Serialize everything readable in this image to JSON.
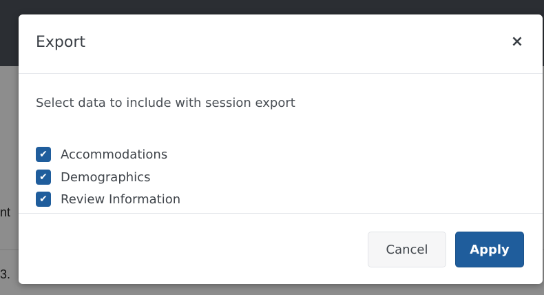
{
  "background": {
    "side_text_1": "nt",
    "side_text_2": "3."
  },
  "dialog": {
    "title": "Export",
    "close_symbol": "×",
    "instructions": "Select data to include with session export",
    "options": [
      {
        "label": "Accommodations",
        "checked": true
      },
      {
        "label": "Demographics",
        "checked": true
      },
      {
        "label": "Review Information",
        "checked": true
      }
    ],
    "check_mark": "✔",
    "cancel_label": "Cancel",
    "apply_label": "Apply"
  },
  "colors": {
    "primary": "#1f5d9c",
    "backdrop": "#8d8d8d",
    "topbar": "#2b2e33"
  }
}
